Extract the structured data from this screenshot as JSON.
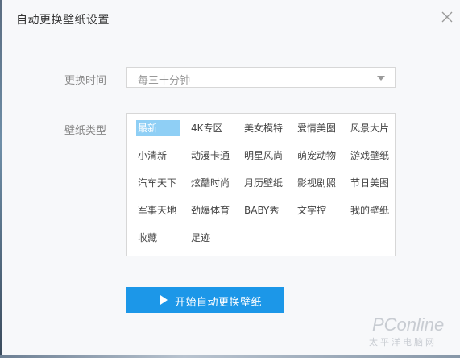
{
  "dialog": {
    "title": "自动更换壁纸设置"
  },
  "interval": {
    "label": "更换时间",
    "selected": "每三十分钟"
  },
  "types": {
    "label": "壁纸类型",
    "items": [
      {
        "label": "最新",
        "selected": true
      },
      {
        "label": "4K专区"
      },
      {
        "label": "美女模特"
      },
      {
        "label": "爱情美图"
      },
      {
        "label": "风景大片"
      },
      {
        "label": "小清新"
      },
      {
        "label": "动漫卡通"
      },
      {
        "label": "明星风尚"
      },
      {
        "label": "萌宠动物"
      },
      {
        "label": "游戏壁纸"
      },
      {
        "label": "汽车天下"
      },
      {
        "label": "炫酷时尚"
      },
      {
        "label": "月历壁纸"
      },
      {
        "label": "影视剧照"
      },
      {
        "label": "节日美图"
      },
      {
        "label": "军事天地"
      },
      {
        "label": "劲爆体育"
      },
      {
        "label": "BABY秀"
      },
      {
        "label": "文字控"
      },
      {
        "label": "我的壁纸"
      },
      {
        "label": "收藏"
      },
      {
        "label": "足迹"
      }
    ]
  },
  "start_button": {
    "label": "开始自动更换壁纸"
  },
  "watermark": {
    "logo": "PConline",
    "sub": "太平洋电脑网"
  },
  "colors": {
    "accent": "#1c97e8",
    "selected_bg": "#8fcff5"
  }
}
